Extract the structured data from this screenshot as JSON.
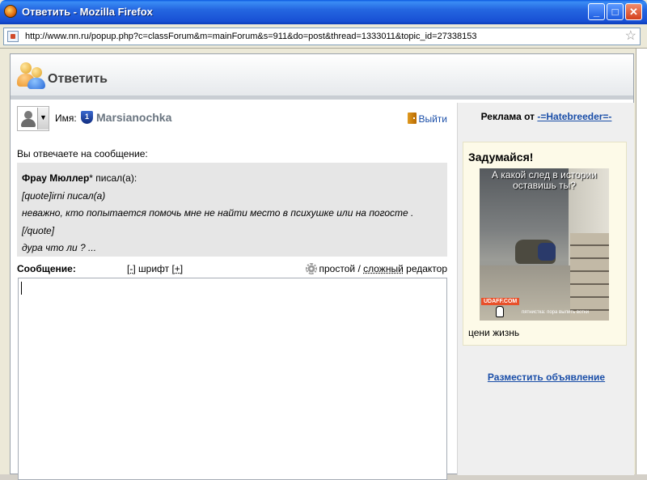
{
  "window": {
    "title": "Ответить - Mozilla Firefox",
    "url": "http://www.nn.ru/popup.php?c=classForum&m=mainForum&s=911&do=post&thread=1333011&topic_id=27338153",
    "minimize": "_",
    "maximize": "□",
    "close": "✕",
    "bookmark_star": "☆"
  },
  "header": {
    "title": "Ответить"
  },
  "user": {
    "name_label": "Имя:",
    "shield_number": "1",
    "username": "Marsianochka",
    "logout": "Выйти"
  },
  "reply": {
    "intro": "Вы отвечаете на сообщение:",
    "quote_author": "Фрау Мюллер",
    "quote_author_suffix": "* писал(а):",
    "quote_lines": [
      "[quote]irni писал(а)",
      "неважно, кто попытается помочь мне не найти место в психушке или на погосте .",
      "[/quote]",
      "дура что ли ? ..."
    ]
  },
  "editor": {
    "message_label": "Сообщение:",
    "font_minus": "[-]",
    "font_label": "шрифт",
    "font_plus": "[+]",
    "mode_simple": "простой",
    "mode_sep": "/",
    "mode_complex": "сложный",
    "mode_suffix": "редактор"
  },
  "sidebar": {
    "ad_from_label": "Реклама от",
    "ad_from_user": "-=Hatebreeder=-",
    "ad_title": "Задумайся!",
    "ad_image_text": "А какой след в истории оставишь ты?",
    "ad_image_logo": "UDAFF.COM",
    "ad_image_caption": "пятнистка: пора вылить вотки",
    "ad_description": "цени жизнь",
    "place_ad": "Разместить объявление"
  }
}
